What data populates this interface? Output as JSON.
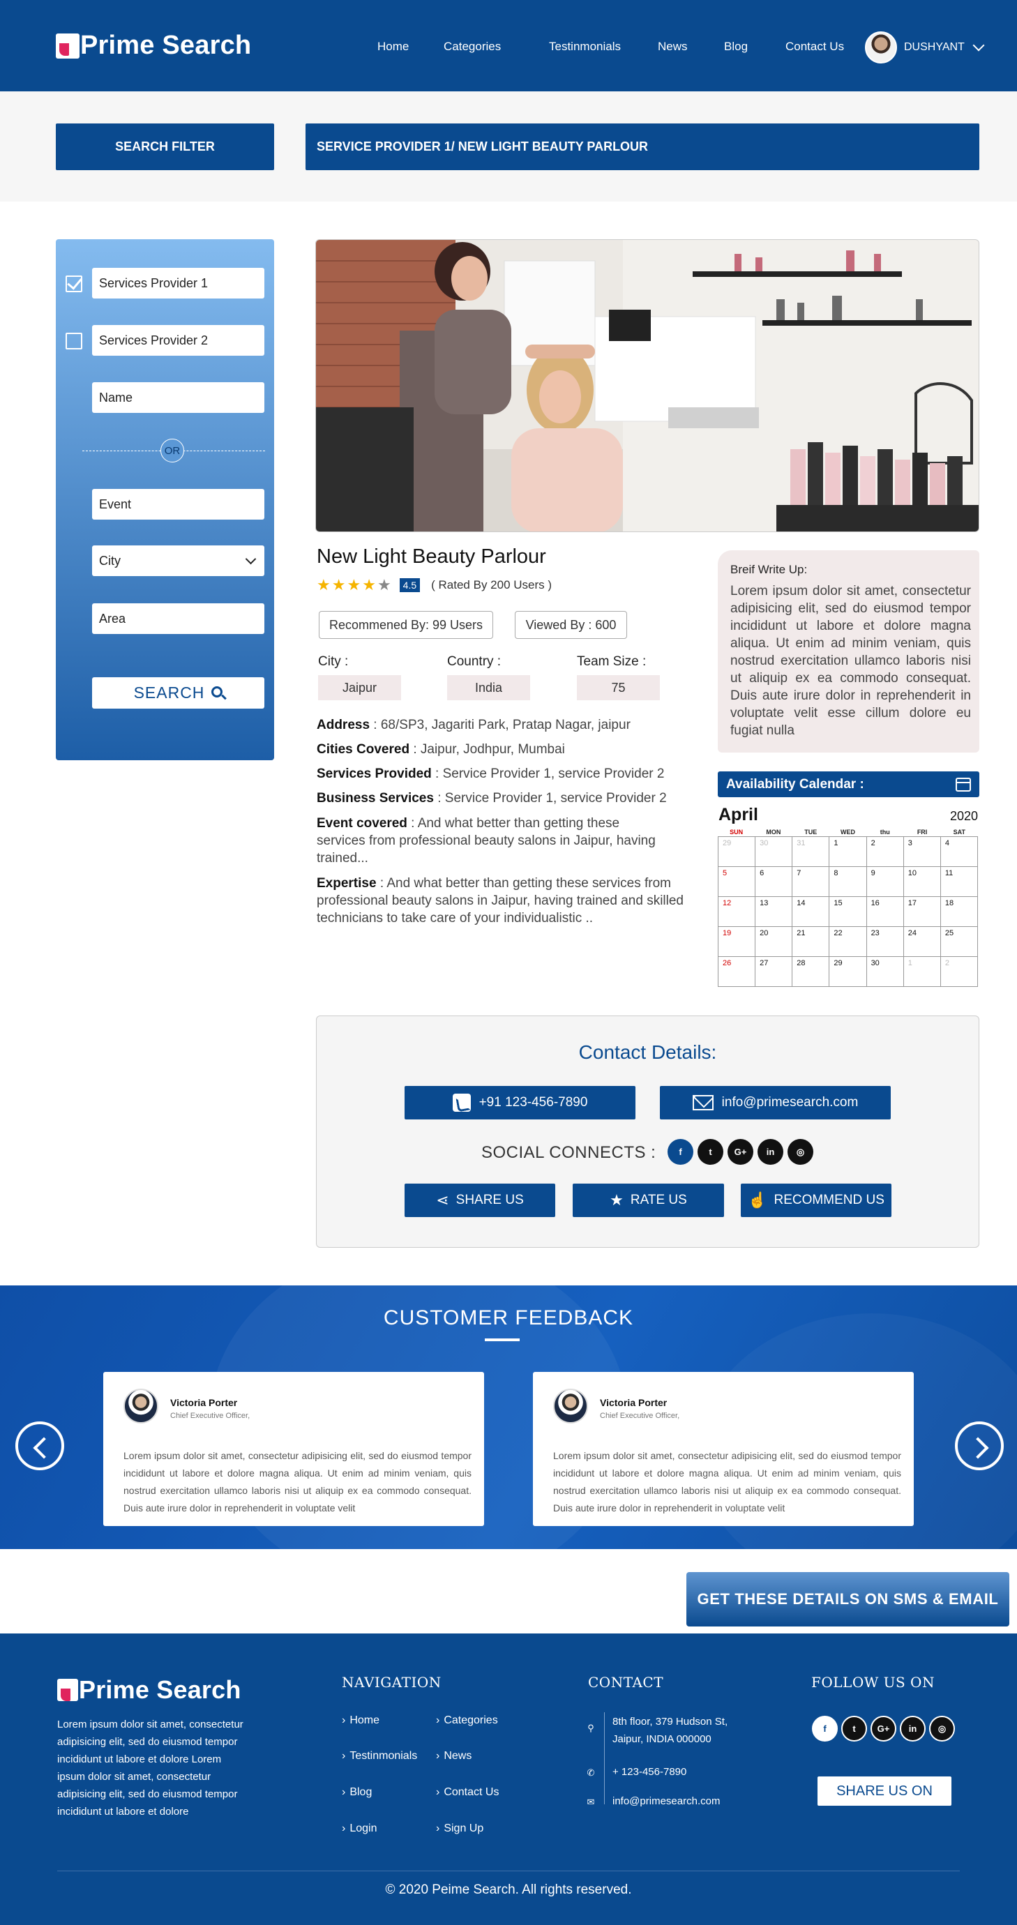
{
  "header": {
    "logo": "Prime Search",
    "nav": [
      "Home",
      "Categories",
      "Testinmonials",
      "News",
      "Blog",
      "Contact Us"
    ],
    "user": "DUSHYANT"
  },
  "filter_bar": {
    "search_filter_label": "SEARCH FILTER",
    "breadcrumb": "SERVICE PROVIDER 1/ NEW LIGHT BEAUTY PARLOUR"
  },
  "sidebar": {
    "provider1": "Services Provider 1",
    "provider1_checked": true,
    "provider2": "Services Provider 2",
    "provider2_checked": false,
    "name_placeholder": "Name",
    "or": "OR",
    "event_placeholder": "Event",
    "city_selected": "City",
    "area_placeholder": "Area",
    "search_label": "SEARCH"
  },
  "business": {
    "title": "New Light Beauty Parlour",
    "rating_stars": 4,
    "rating_value": "4.5",
    "rated_by": "( Rated By 200 Users )",
    "recommended": "Recommened By: 99 Users",
    "viewed": "Viewed By : 600",
    "city_label": "City :",
    "city": "Jaipur",
    "country_label": "Country :",
    "country": "India",
    "team_label": "Team Size :",
    "team_size": "75",
    "address_label": "Address",
    "address": " : 68/SP3, Jagariti Park, Pratap Nagar, jaipur",
    "cities_label": "Cities Covered",
    "cities": " : Jaipur, Jodhpur, Mumbai",
    "services_label": "Services Provided",
    "services": " : Service Provider 1, service Provider 2",
    "business_label": "Business Services",
    "business_services": " : Service Provider 1, service Provider 2",
    "event_label": "Event  covered",
    "event": " : And what better than getting these services from professional beauty salons in Jaipur, having trained...",
    "expertise_label": "Expertise",
    "expertise": " : And what better than getting these services from professional beauty salons in Jaipur, having trained and skilled technicians to take care of your individualistic .."
  },
  "brief": {
    "title": "Breif Write Up:",
    "text": "Lorem ipsum dolor sit amet, consectetur adipisicing elit, sed do eiusmod tempor incididunt ut labore et dolore magna aliqua. Ut enim ad minim veniam, quis nostrud exercitation ullamco laboris nisi ut aliquip ex ea commodo consequat. Duis aute irure dolor in reprehenderit in voluptate velit esse cillum dolore eu fugiat nulla"
  },
  "calendar": {
    "title": "Availability Calendar  :",
    "month": "April",
    "year": "2020",
    "days": [
      "SUN",
      "MON",
      "TUE",
      "WED",
      "thu",
      "FRI",
      "SAT"
    ],
    "weeks": [
      [
        "29",
        "30",
        "31",
        "1",
        "2",
        "3",
        "4"
      ],
      [
        "5",
        "6",
        "7",
        "8",
        "9",
        "10",
        "11"
      ],
      [
        "12",
        "13",
        "14",
        "15",
        "16",
        "17",
        "18"
      ],
      [
        "19",
        "20",
        "21",
        "22",
        "23",
        "24",
        "25"
      ],
      [
        "26",
        "27",
        "28",
        "29",
        "30",
        "1",
        "2"
      ]
    ]
  },
  "contact": {
    "title": "Contact Details:",
    "phone": "+91 123-456-7890",
    "email": "info@primesearch.com",
    "social_label": "SOCIAL CONNECTS :",
    "share": "SHARE US",
    "rate": "RATE US",
    "recommend": "RECOMMEND US"
  },
  "feedback": {
    "title": "CUSTOMER FEEDBACK",
    "cards": [
      {
        "name": "Victoria Porter",
        "role": "Chief Executive Officer,",
        "text": "Lorem ipsum dolor sit amet, consectetur adipisicing elit, sed do eiusmod tempor incididunt ut labore et dolore magna aliqua. Ut enim ad minim veniam, quis nostrud exercitation ullamco laboris nisi ut aliquip ex ea commodo consequat. Duis aute irure dolor in reprehenderit in voluptate velit"
      },
      {
        "name": "Victoria Porter",
        "role": "Chief Executive Officer,",
        "text": "Lorem ipsum dolor sit amet, consectetur adipisicing elit, sed do eiusmod tempor incididunt ut labore et dolore magna aliqua. Ut enim ad minim veniam, quis nostrud exercitation ullamco laboris nisi ut aliquip ex ea commodo consequat. Duis aute irure dolor in reprehenderit in voluptate velit"
      }
    ]
  },
  "sms_button": "GET THESE DETAILS ON SMS & EMAIL",
  "footer": {
    "logo": "Prime Search",
    "about": "Lorem ipsum dolor sit amet, consectetur adipisicing elit, sed do eiusmod tempor incididunt ut labore et dolore Lorem ipsum dolor sit amet, consectetur adipisicing elit, sed do eiusmod tempor incididunt ut labore et dolore",
    "nav_title": "NAVIGATION",
    "nav_links": [
      "Home",
      "Categories",
      "Testinmonials",
      "News",
      "Blog",
      "Contact Us",
      "Login",
      "Sign Up"
    ],
    "contact_title": "CONTACT",
    "address_line1": "8th floor, 379 Hudson St,",
    "address_line2": "Jaipur, INDIA 000000",
    "phone": "+ 123-456-7890",
    "email": "info@primesearch.com",
    "follow_title": "FOLLOW US ON",
    "share_button": "SHARE US ON",
    "copyright": "© 2020  Peime Search. All rights reserved."
  },
  "colors": {
    "brand": "#0a4a8f",
    "accent": "#e0245e",
    "star": "#f5b400"
  }
}
